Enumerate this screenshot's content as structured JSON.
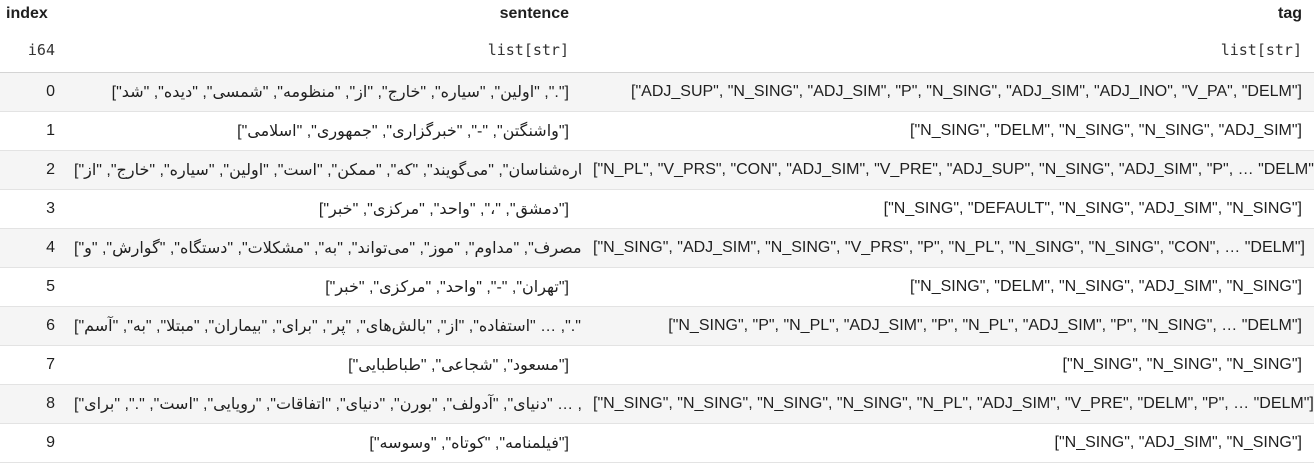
{
  "columns": {
    "index": {
      "name": "index",
      "dtype": "i64"
    },
    "sentence": {
      "name": "sentence",
      "dtype": "list[str]"
    },
    "tag": {
      "name": "tag",
      "dtype": "list[str]"
    }
  },
  "rows": [
    {
      "index": "0",
      "sentence": "[\".\", \"اولین\", \"سیاره\", \"خارج\", \"از\", \"منظومه\", \"شمسی\", \"دیده\", \"شد\"]",
      "tag": "[\"ADJ_SUP\", \"N_SING\", \"ADJ_SIM\", \"P\", \"N_SING\", \"ADJ_SIM\", \"ADJ_INO\", \"V_PA\", \"DELM\"]"
    },
    {
      "index": "1",
      "sentence": "[\"واشنگتن\", \"-\", \"خبرگزاری\", \"جمهوری\", \"اسلامی\"]",
      "tag": "[\"N_SING\", \"DELM\", \"N_SING\", \"N_SING\", \"ADJ_SIM\"]"
    },
    {
      "index": "2",
      "sentence": "[\".\", … \"ستاره‌شناسان\", \"می‌گویند\", \"که\", \"ممکن\", \"است\", \"اولین\", \"سیاره\", \"خارج\", \"از\"]",
      "tag": "[\"N_PL\", \"V_PRS\", \"CON\", \"ADJ_SIM\", \"V_PRE\", \"ADJ_SUP\", \"N_SING\", \"ADJ_SIM\", \"P\", … \"DELM\"]"
    },
    {
      "index": "3",
      "sentence": "[\"دمشق\", \"،\", \"واحد\", \"مرکزی\", \"خبر\"]",
      "tag": "[\"N_SING\", \"DEFAULT\", \"N_SING\", \"ADJ_SIM\", \"N_SING\"]"
    },
    {
      "index": "4",
      "sentence": "[\".\", … \"مصرف\", \"مداوم\", \"موز\", \"می‌تواند\", \"به\", \"مشکلات\", \"دستگاه\", \"گوارش\", \"و\"]",
      "tag": "[\"N_SING\", \"ADJ_SIM\", \"N_SING\", \"V_PRS\", \"P\", \"N_PL\", \"N_SING\", \"N_SING\", \"CON\", … \"DELM\"]"
    },
    {
      "index": "5",
      "sentence": "[\"تهران\", \"-\", \"واحد\", \"مرکزی\", \"خبر\"]",
      "tag": "[\"N_SING\", \"DELM\", \"N_SING\", \"ADJ_SIM\", \"N_SING\"]"
    },
    {
      "index": "6",
      "sentence": "[\".\", … \"استفاده\", \"از\", \"بالش‌های\", \"پر\", \"برای\", \"بیماران\", \"مبتلا\", \"به\", \"آسم\"]",
      "tag": "[\"N_SING\", \"P\", \"N_PL\", \"ADJ_SIM\", \"P\", \"N_PL\", \"ADJ_SIM\", \"P\", \"N_SING\", … \"DELM\"]"
    },
    {
      "index": "7",
      "sentence": "[\"مسعود\", \"شجاعی\", \"طباطبایی\"]",
      "tag": "[\"N_SING\", \"N_SING\", \"N_SING\"]"
    },
    {
      "index": "8",
      "sentence": "[\".\", … \"دنیای\", \"آدولف\", \"بورن\", \"دنیای\", \"اتفاقات\", \"رویایی\", \"است\", \".\", \"برای\"]",
      "tag": "[\"N_SING\", \"N_SING\", \"N_SING\", \"N_SING\", \"N_PL\", \"ADJ_SIM\", \"V_PRE\", \"DELM\", \"P\", … \"DELM\"]"
    },
    {
      "index": "9",
      "sentence": "[\"فیلمنامه\", \"کوتاه\", \"وسوسه\"]",
      "tag": "[\"N_SING\", \"ADJ_SIM\", \"N_SING\"]"
    }
  ]
}
